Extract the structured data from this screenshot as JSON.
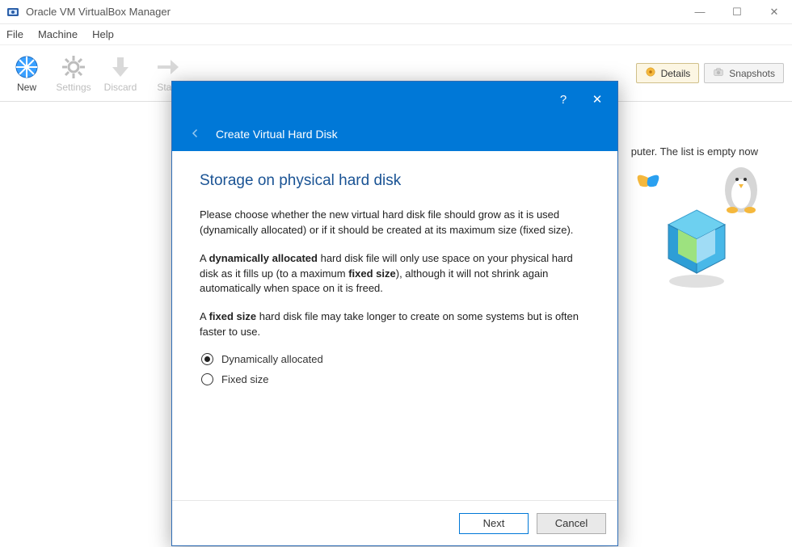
{
  "window": {
    "title": "Oracle VM VirtualBox Manager"
  },
  "menubar": {
    "file": "File",
    "machine": "Machine",
    "help": "Help"
  },
  "toolbar": {
    "new": "New",
    "settings": "Settings",
    "discard": "Discard",
    "start": "Start"
  },
  "right_buttons": {
    "details": "Details",
    "snapshots": "Snapshots"
  },
  "main_hint_tail": "puter. The list is empty now",
  "dialog": {
    "title": "Create Virtual Hard Disk",
    "heading": "Storage on physical hard disk",
    "p1": "Please choose whether the new virtual hard disk file should grow as it is used (dynamically allocated) or if it should be created at its maximum size (fixed size).",
    "p2_a": "A ",
    "p2_b": "dynamically allocated",
    "p2_c": " hard disk file will only use space on your physical hard disk as it fills up (to a maximum ",
    "p2_d": "fixed size",
    "p2_e": "), although it will not shrink again automatically when space on it is freed.",
    "p3_a": "A ",
    "p3_b": "fixed size",
    "p3_c": " hard disk file may take longer to create on some systems but is often faster to use.",
    "opt1": "Dynamically allocated",
    "opt2": "Fixed size",
    "selected": "opt1",
    "next": "Next",
    "cancel": "Cancel"
  }
}
